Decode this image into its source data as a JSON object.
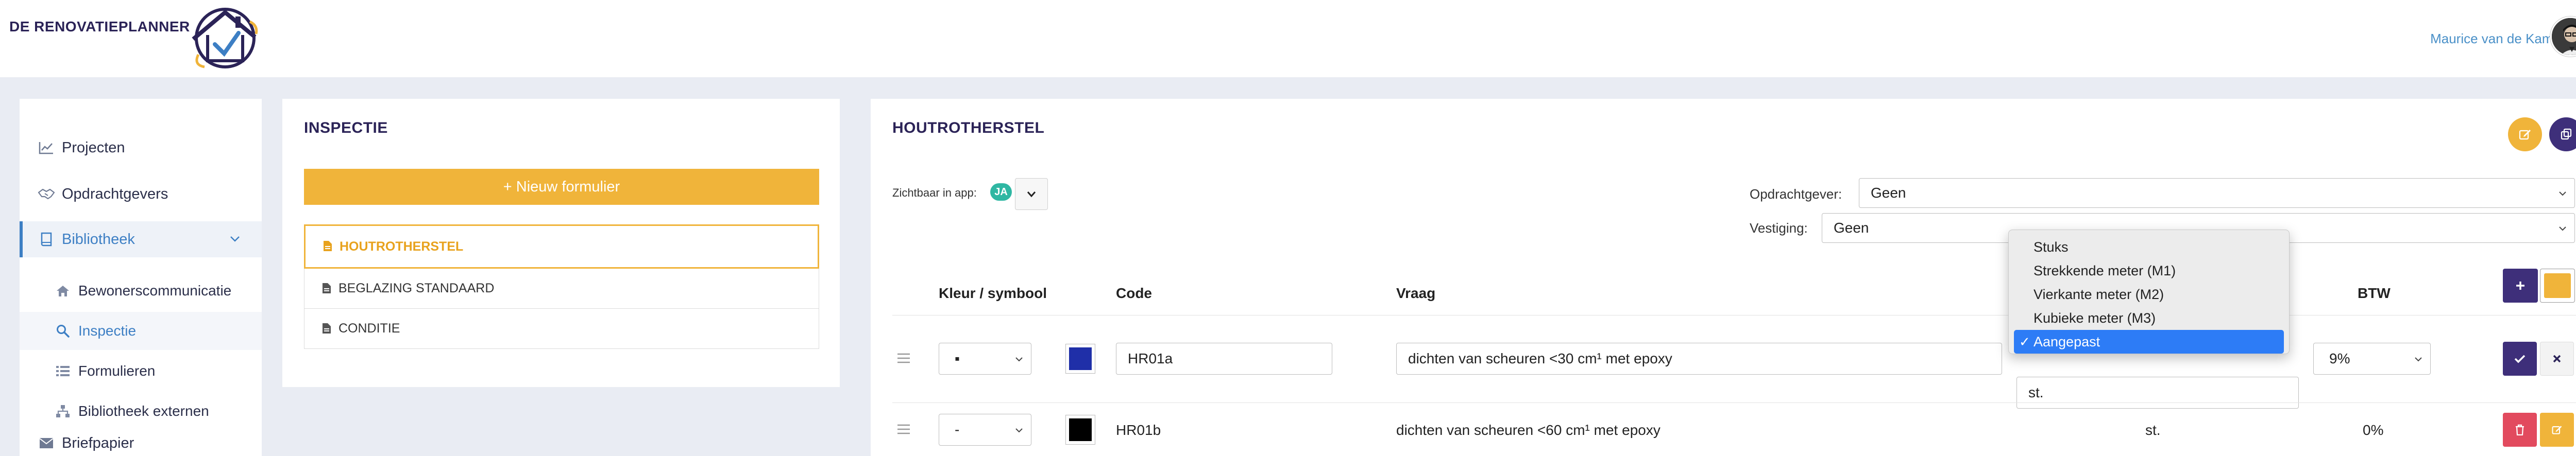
{
  "header": {
    "brand": "DE RENOVATIEPLANNER",
    "user_name": "Maurice van de Kamp"
  },
  "sidebar": {
    "items": [
      {
        "label": "Projecten",
        "icon": "chart-line-icon"
      },
      {
        "label": "Opdrachtgevers",
        "icon": "handshake-icon"
      },
      {
        "label": "Bibliotheek",
        "icon": "book-icon"
      }
    ],
    "sub_items": [
      {
        "label": "Bewonerscommunicatie",
        "icon": "home-icon"
      },
      {
        "label": "Inspectie",
        "icon": "search-icon"
      },
      {
        "label": "Formulieren",
        "icon": "list-icon"
      },
      {
        "label": "Bibliotheek externen",
        "icon": "sitemap-icon"
      }
    ],
    "last_item": {
      "label": "Briefpapier",
      "icon": "envelope-icon"
    }
  },
  "inspectie": {
    "title": "INSPECTIE",
    "new_button": "+ Nieuw formulier",
    "forms": [
      "HOUTROTHERSTEL",
      "BEGLAZING STANDAARD",
      "CONDITIE"
    ]
  },
  "detail": {
    "title": "HOUTROTHERSTEL",
    "visible_label": "Zichtbaar in app:",
    "visible_value": "JA",
    "client_label": "Opdrachtgever:",
    "client_value": "Geen",
    "branch_label": "Vestiging:",
    "branch_value": "Geen",
    "columns": {
      "color": "Kleur / symbool",
      "code": "Code",
      "question": "Vraag",
      "btw": "BTW"
    },
    "rows": [
      {
        "symbol": "▪",
        "color": "#1f2fa8",
        "code": "HR01a",
        "question": "dichten van scheuren <30 cm¹ met epoxy",
        "unit": "st.",
        "btw": "9%"
      },
      {
        "symbol": "-",
        "color": "#000000",
        "code": "HR01b",
        "question": "dichten van scheuren <60 cm¹ met epoxy",
        "unit": "st.",
        "btw": "0%"
      }
    ],
    "unit_options": [
      "Stuks",
      "Strekkende meter (M1)",
      "Vierkante meter (M2)",
      "Kubieke meter (M3)",
      "Aangepast"
    ],
    "unit_selected": "Aangepast"
  },
  "colors": {
    "accent_yellow": "#f0b43a",
    "accent_purple": "#3e2f7a",
    "link_blue": "#3d7fc4",
    "badge_teal": "#2fb7a3",
    "delete_red": "#e24a5e"
  }
}
